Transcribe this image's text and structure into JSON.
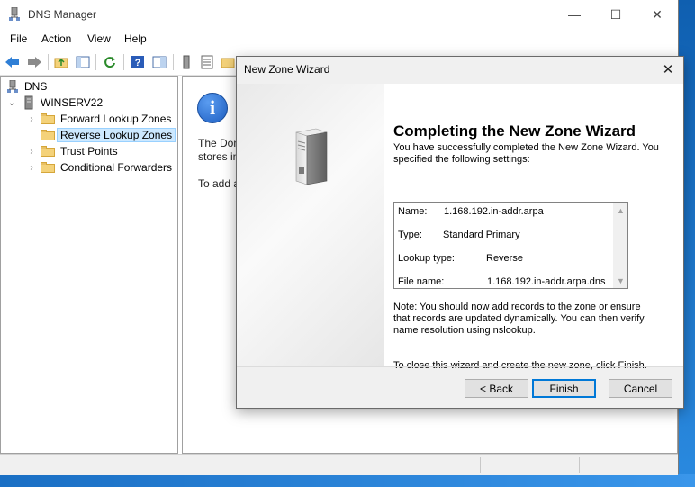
{
  "window": {
    "title": "DNS Manager",
    "minimize": "—",
    "maximize": "☐",
    "close": "✕"
  },
  "menu": [
    "File",
    "Action",
    "View",
    "Help"
  ],
  "tree": {
    "root": "DNS",
    "server": "WINSERV22",
    "items": [
      {
        "label": "Forward Lookup Zones",
        "selected": false
      },
      {
        "label": "Reverse Lookup Zones",
        "selected": true
      },
      {
        "label": "Trust Points",
        "selected": false
      },
      {
        "label": "Conditional Forwarders",
        "selected": false
      }
    ]
  },
  "content": {
    "line1": "The Don",
    "line2": "stores in",
    "line3": "To add a"
  },
  "dialog": {
    "title": "New Zone Wizard",
    "close": "✕",
    "heading": "Completing the New Zone Wizard",
    "intro": "You have successfully completed the New Zone Wizard. You specified the following settings:",
    "summary": [
      {
        "label": "Name:",
        "value": "1.168.192.in-addr.arpa"
      },
      {
        "label": "Type:",
        "value": "Standard Primary"
      },
      {
        "label": "Lookup type:",
        "value": "Reverse"
      },
      {
        "label": "File name:",
        "value": "1.168.192.in-addr.arpa.dns"
      }
    ],
    "note": "Note: You should now add records to the zone or ensure that records are updated dynamically. You can then verify name resolution using nslookup.",
    "closing": "To close this wizard and create the new zone, click Finish.",
    "buttons": {
      "back": "< Back",
      "finish": "Finish",
      "cancel": "Cancel"
    }
  },
  "colors": {
    "accent": "#0078d7",
    "selection": "#cce8ff",
    "desktop": "#1a76c7"
  }
}
